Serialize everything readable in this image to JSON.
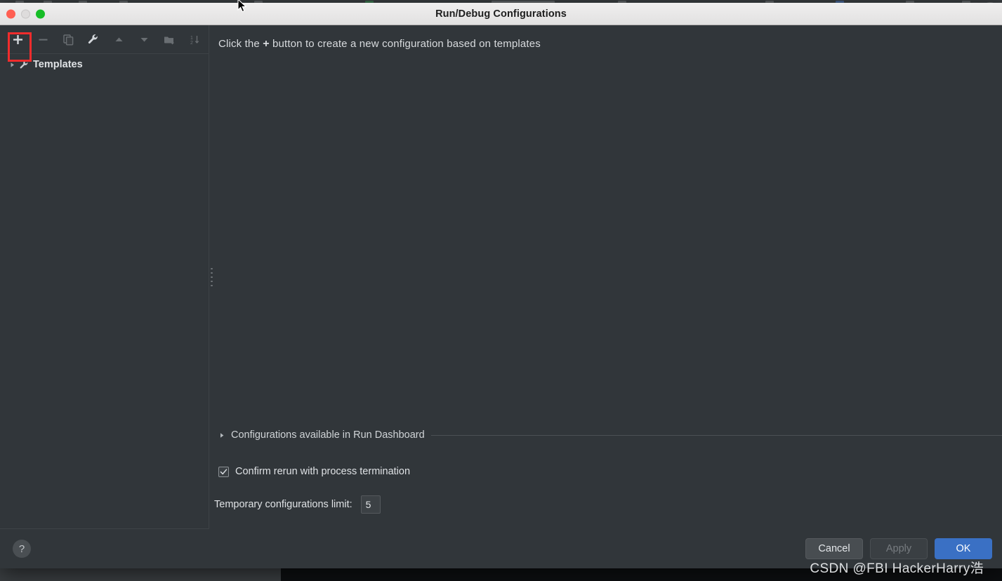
{
  "window": {
    "title": "Run/Debug Configurations",
    "traffic_lights": [
      "close",
      "minimize",
      "maximize"
    ]
  },
  "toolbar": {
    "buttons": [
      {
        "name": "add",
        "icon": "plus-icon",
        "enabled": true,
        "highlighted": true
      },
      {
        "name": "remove",
        "icon": "minus-icon",
        "enabled": false
      },
      {
        "name": "copy",
        "icon": "copy-icon",
        "enabled": false
      },
      {
        "name": "edit-templates",
        "icon": "wrench-icon",
        "enabled": true
      },
      {
        "name": "move-up",
        "icon": "arrow-up-icon",
        "enabled": false
      },
      {
        "name": "move-down",
        "icon": "arrow-down-icon",
        "enabled": false
      },
      {
        "name": "move-into-folder",
        "icon": "folder-add-icon",
        "enabled": false
      },
      {
        "name": "sort",
        "icon": "sort-icon",
        "enabled": false
      }
    ]
  },
  "tree": {
    "items": [
      {
        "label": "Templates",
        "icon": "wrench-icon",
        "expanded": false
      }
    ]
  },
  "main": {
    "hint_prefix": "Click the",
    "hint_plus": "+",
    "hint_suffix": "button to create a new configuration based on templates",
    "run_dashboard_section": {
      "label": "Configurations available in Run Dashboard",
      "expanded": false
    },
    "confirm_rerun": {
      "label": "Confirm rerun with process termination",
      "checked": true
    },
    "temporary_limit": {
      "label": "Temporary configurations limit:",
      "value": "5"
    }
  },
  "footer": {
    "help_label": "?",
    "cancel_label": "Cancel",
    "apply_label": "Apply",
    "apply_enabled": false,
    "ok_label": "OK"
  },
  "watermark": {
    "text": "CSDN @FBI HackerHarry浩"
  },
  "colors": {
    "dialog_bg": "#31363a",
    "titlebar_bg": "#eceaea",
    "accent_primary": "#3a70c4",
    "annotation_red": "#f22c2c",
    "text_primary": "#dfe2e5"
  }
}
